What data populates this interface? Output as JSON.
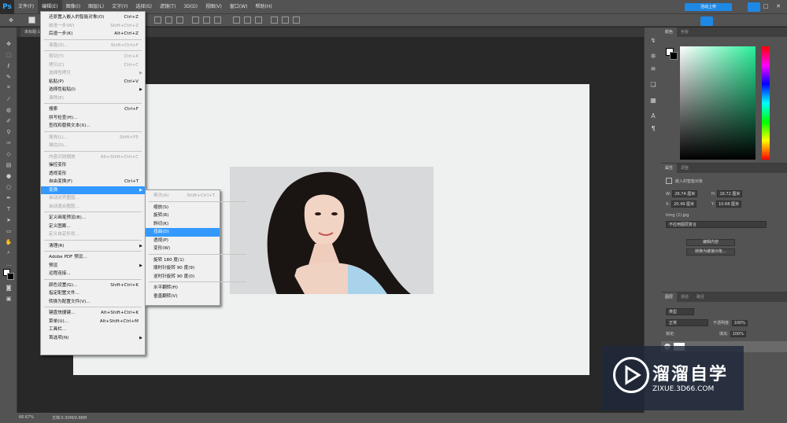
{
  "app": {
    "logo": "Ps"
  },
  "menubar": {
    "items": [
      "文件(F)",
      "编辑(E)",
      "图像(I)",
      "图层(L)",
      "文字(Y)",
      "选择(S)",
      "滤镜(T)",
      "3D(D)",
      "视图(V)",
      "窗口(W)",
      "帮助(H)"
    ],
    "active_index": 1
  },
  "cloud": {
    "button_label": "活动上传"
  },
  "tab": {
    "label": "未标题-1"
  },
  "status": {
    "zoom": "66.67%",
    "doc": "文档:5.93M/0.88M"
  },
  "edit_menu": {
    "items": [
      {
        "label": "还原置入嵌入的智能对象(O)",
        "shortcut": "Ctrl+Z",
        "disabled": false
      },
      {
        "label": "前进一步(W)",
        "shortcut": "Shift+Ctrl+Z",
        "disabled": true
      },
      {
        "label": "后退一步(K)",
        "shortcut": "Alt+Ctrl+Z",
        "disabled": false
      },
      {
        "sep": true
      },
      {
        "label": "渐隐(D)...",
        "shortcut": "Shift+Ctrl+F",
        "disabled": true
      },
      {
        "sep": true
      },
      {
        "label": "剪切(T)",
        "shortcut": "Ctrl+X",
        "disabled": true
      },
      {
        "label": "拷贝(C)",
        "shortcut": "Ctrl+C",
        "disabled": true
      },
      {
        "label": "选择性拷贝",
        "shortcut": "",
        "disabled": true,
        "submenu": true
      },
      {
        "label": "粘贴(P)",
        "shortcut": "Ctrl+V",
        "disabled": false
      },
      {
        "label": "选择性粘贴(I)",
        "shortcut": "",
        "disabled": false,
        "submenu": true
      },
      {
        "label": "清除(E)",
        "shortcut": "",
        "disabled": true
      },
      {
        "sep": true
      },
      {
        "label": "搜索",
        "shortcut": "Ctrl+F",
        "disabled": false
      },
      {
        "label": "拼写检查(H)...",
        "shortcut": "",
        "disabled": false
      },
      {
        "label": "查找和替换文本(X)...",
        "shortcut": "",
        "disabled": false
      },
      {
        "sep": true
      },
      {
        "label": "填充(L)...",
        "shortcut": "Shift+F5",
        "disabled": true
      },
      {
        "label": "描边(S)...",
        "shortcut": "",
        "disabled": true
      },
      {
        "sep": true
      },
      {
        "label": "内容识别缩放",
        "shortcut": "Alt+Shift+Ctrl+C",
        "disabled": true
      },
      {
        "label": "操控变形",
        "shortcut": "",
        "disabled": false
      },
      {
        "label": "透视变形",
        "shortcut": "",
        "disabled": false
      },
      {
        "label": "自由变换(F)",
        "shortcut": "Ctrl+T",
        "disabled": false
      },
      {
        "label": "变换",
        "shortcut": "",
        "disabled": false,
        "submenu": true,
        "highlight": true
      },
      {
        "label": "自动对齐图层...",
        "shortcut": "",
        "disabled": true
      },
      {
        "label": "自动混合图层...",
        "shortcut": "",
        "disabled": true
      },
      {
        "sep": true
      },
      {
        "label": "定义画笔预设(B)...",
        "shortcut": "",
        "disabled": false
      },
      {
        "label": "定义图案...",
        "shortcut": "",
        "disabled": false
      },
      {
        "label": "定义自定形状...",
        "shortcut": "",
        "disabled": true
      },
      {
        "sep": true
      },
      {
        "label": "清理(R)",
        "shortcut": "",
        "disabled": false,
        "submenu": true
      },
      {
        "sep": true
      },
      {
        "label": "Adobe PDF 预设...",
        "shortcut": "",
        "disabled": false
      },
      {
        "label": "预设",
        "shortcut": "",
        "disabled": false,
        "submenu": true
      },
      {
        "label": "远程连接...",
        "shortcut": "",
        "disabled": false
      },
      {
        "sep": true
      },
      {
        "label": "颜色设置(G)...",
        "shortcut": "Shift+Ctrl+K",
        "disabled": false
      },
      {
        "label": "指定配置文件...",
        "shortcut": "",
        "disabled": false
      },
      {
        "label": "转换为配置文件(V)...",
        "shortcut": "",
        "disabled": false
      },
      {
        "sep": true
      },
      {
        "label": "键盘快捷键...",
        "shortcut": "Alt+Shift+Ctrl+K",
        "disabled": false
      },
      {
        "label": "菜单(U)...",
        "shortcut": "Alt+Shift+Ctrl+M",
        "disabled": false
      },
      {
        "label": "工具栏...",
        "shortcut": "",
        "disabled": false
      },
      {
        "label": "首选项(N)",
        "shortcut": "",
        "disabled": false,
        "submenu": true
      }
    ]
  },
  "transform_menu": {
    "items": [
      {
        "label": "再次(A)",
        "shortcut": "Shift+Ctrl+T",
        "disabled": true
      },
      {
        "sep": true
      },
      {
        "label": "缩放(S)",
        "shortcut": "",
        "disabled": false
      },
      {
        "label": "旋转(R)",
        "shortcut": "",
        "disabled": false
      },
      {
        "label": "斜切(K)",
        "shortcut": "",
        "disabled": false
      },
      {
        "label": "扭曲(D)",
        "shortcut": "",
        "disabled": false,
        "highlight": true
      },
      {
        "label": "透视(P)",
        "shortcut": "",
        "disabled": false
      },
      {
        "label": "变形(W)",
        "shortcut": "",
        "disabled": false
      },
      {
        "sep": true
      },
      {
        "label": "旋转 180 度(1)",
        "shortcut": "",
        "disabled": false
      },
      {
        "label": "顺时针旋转 90 度(9)",
        "shortcut": "",
        "disabled": false
      },
      {
        "label": "逆时针旋转 90 度(0)",
        "shortcut": "",
        "disabled": false
      },
      {
        "sep": true
      },
      {
        "label": "水平翻转(H)",
        "shortcut": "",
        "disabled": false
      },
      {
        "label": "垂直翻转(V)",
        "shortcut": "",
        "disabled": false
      }
    ]
  },
  "color_panel": {
    "tabs": [
      "颜色",
      "色板"
    ]
  },
  "properties_panel": {
    "tabs": [
      "属性",
      "调整"
    ],
    "object_type": "嵌入的智能对象",
    "w_label": "W:",
    "w_value": "26.74 厘米",
    "h_label": "H:",
    "h_value": "16.72 厘米",
    "x_label": "X:",
    "x_value": "20.49 厘米",
    "y_label": "Y:",
    "y_value": "10.68 厘米",
    "filename": "timg (2).jpg",
    "comp_label": "不应用图层复合",
    "edit_button": "编辑内容",
    "convert_button": "转换为链接对象..."
  },
  "layers_panel": {
    "tabs": [
      "图层",
      "通道",
      "路径"
    ],
    "filter_label": "类型",
    "blend_mode": "正常",
    "opacity_label": "不透明度:",
    "opacity_value": "100%",
    "lock_label": "锁定:",
    "fill_label": "填充:",
    "fill_value": "100%"
  },
  "watermark": {
    "title": "溜溜自学",
    "url": "ZIXUE.3D66.COM"
  }
}
